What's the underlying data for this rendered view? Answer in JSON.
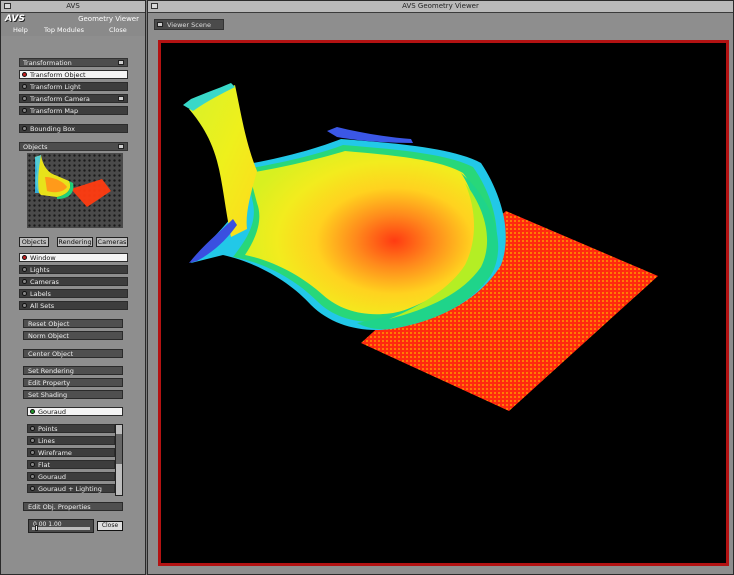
{
  "left_window": {
    "title": "AVS",
    "brand": "AVS",
    "brand_right": "Geometry Viewer",
    "menu": [
      "Help",
      "Top Modules",
      "Close"
    ]
  },
  "transformations": {
    "header": "Transformation",
    "items": [
      {
        "label": "Transform Object",
        "selected": true
      },
      {
        "label": "Transform Light",
        "selected": false
      },
      {
        "label": "Transform Camera",
        "selected": false
      },
      {
        "label": "Transform Map",
        "selected": false
      }
    ],
    "bounding_box": "Bounding Box"
  },
  "objects": {
    "header": "Objects",
    "tabs": [
      "Objects",
      "Rendering",
      "Cameras"
    ],
    "items": [
      {
        "label": "Window",
        "selected": true
      },
      {
        "label": "Lights",
        "selected": false
      },
      {
        "label": "Cameras",
        "selected": false
      },
      {
        "label": "Labels",
        "selected": false
      },
      {
        "label": "All Sets",
        "selected": false
      }
    ]
  },
  "action_buttons": [
    "Reset Object",
    "Norm Object",
    "Center Object",
    "Set Rendering",
    "Edit Property",
    "Set Shading"
  ],
  "render_mode": {
    "label": "Gouraud",
    "selected": true
  },
  "render_options": [
    "Points",
    "Lines",
    "Wireframe",
    "Flat",
    "Gouraud",
    "Gouraud + Lighting"
  ],
  "property_button": "Edit Obj. Properties",
  "slider": {
    "value_label": "0.00 1.00",
    "value": 0.05
  },
  "small_button": "Close",
  "right_window": {
    "title": "AVS Geometry Viewer",
    "sub_label": "Viewer Scene"
  },
  "colors": {
    "viewport_border": "#b31212",
    "background": "#000000",
    "panel": "#8e8e8e"
  }
}
